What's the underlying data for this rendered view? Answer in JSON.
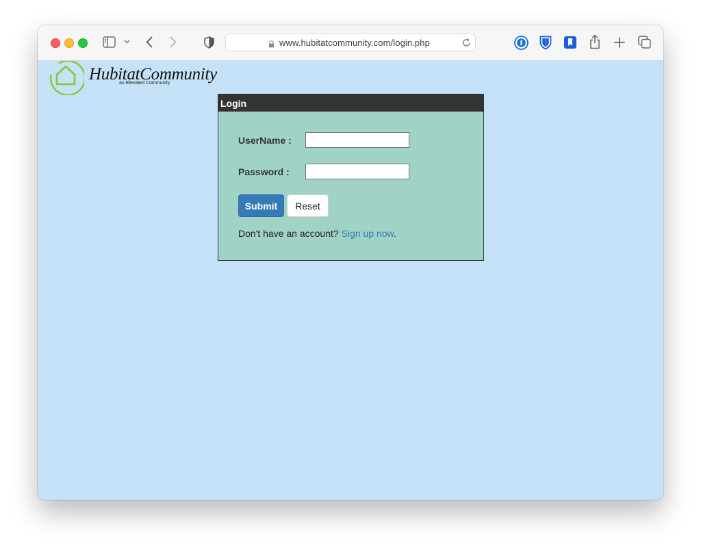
{
  "browser": {
    "url": "www.hubitatcommunity.com/login.php",
    "icons": {
      "close": "close-traffic-light",
      "minimize": "minimize-traffic-light",
      "maximize": "maximize-traffic-light",
      "sidebar": "sidebar-icon",
      "back": "chevron-left-icon",
      "forward": "chevron-right-icon",
      "privacy": "shield-icon",
      "lock": "lock-icon",
      "reload": "reload-icon",
      "onepassword": "1password-icon",
      "bitwarden": "bitwarden-icon",
      "bookmark": "bookmark-icon",
      "share": "share-icon",
      "new_tab": "plus-icon",
      "tabs": "tabs-overview-icon"
    }
  },
  "logo": {
    "name": "HubitatCommunity",
    "tagline": "an Elevated Community"
  },
  "login": {
    "title": "Login",
    "username_label": "UserName :",
    "username_value": "",
    "password_label": "Password :",
    "password_value": "",
    "submit_label": "Submit",
    "reset_label": "Reset",
    "signup_prefix": "Don't have an account?",
    "signup_link": "Sign up now",
    "signup_suffix": "."
  },
  "colors": {
    "page_bg": "#c5e2f8",
    "box_bg": "#a0d3c6",
    "header_bg": "#333333",
    "primary": "#337ab7",
    "logo_green": "#8cc63f"
  }
}
